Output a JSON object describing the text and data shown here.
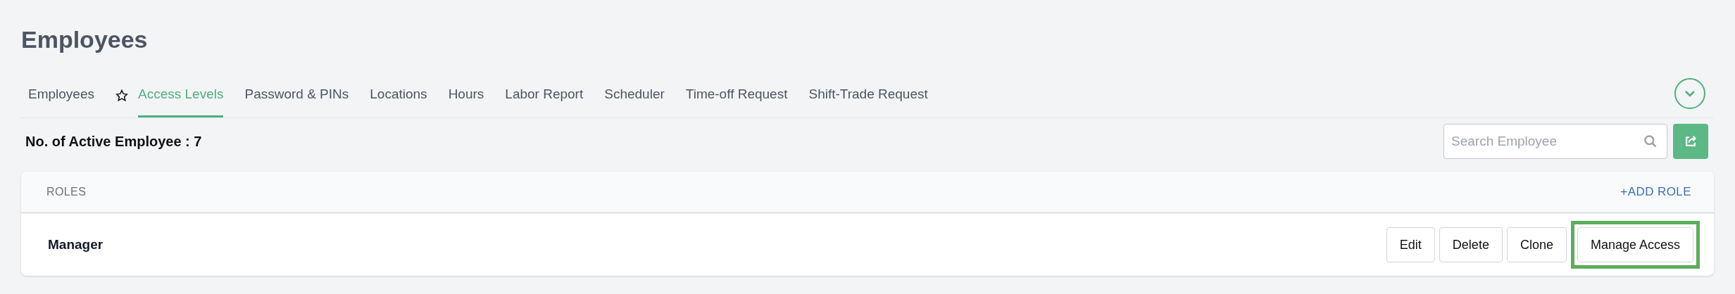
{
  "page_title": "Employees",
  "tabs": [
    {
      "label": "Employees",
      "selected": false,
      "starred": false
    },
    {
      "label": "Access Levels",
      "selected": true,
      "starred": true
    },
    {
      "label": "Password & PINs",
      "selected": false,
      "starred": false
    },
    {
      "label": "Locations",
      "selected": false,
      "starred": false
    },
    {
      "label": "Hours",
      "selected": false,
      "starred": false
    },
    {
      "label": "Labor Report",
      "selected": false,
      "starred": false
    },
    {
      "label": "Scheduler",
      "selected": false,
      "starred": false
    },
    {
      "label": "Time-off Request",
      "selected": false,
      "starred": false
    },
    {
      "label": "Shift-Trade Request",
      "selected": false,
      "starred": false
    }
  ],
  "active_count": "No. of Active Employee : 7",
  "search": {
    "placeholder": "Search Employee"
  },
  "roles_card": {
    "header": "ROLES",
    "add_link": "+ADD ROLE",
    "rows": [
      {
        "name": "Manager",
        "actions": [
          {
            "label": "Edit",
            "highlighted": false
          },
          {
            "label": "Delete",
            "highlighted": false
          },
          {
            "label": "Clone",
            "highlighted": false
          },
          {
            "label": "Manage Access",
            "highlighted": true
          }
        ]
      }
    ]
  }
}
